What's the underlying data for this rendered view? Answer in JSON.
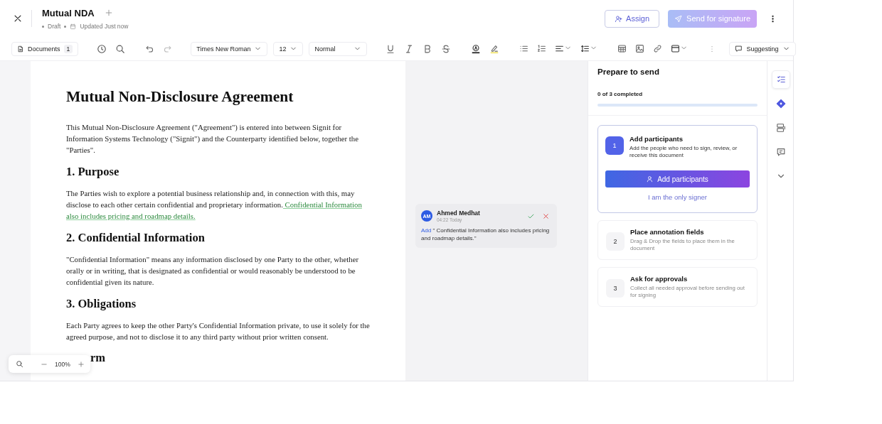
{
  "header": {
    "title": "Mutual NDA",
    "status": "Draft",
    "updated": "Updated Just now",
    "assign": "Assign",
    "send": {
      "label": "Send for signature",
      "disabled": true
    }
  },
  "toolbar": {
    "documents": "Documents",
    "documents_count": "1",
    "font": "Times New Roman",
    "size": "12",
    "style": "Normal",
    "mode": "Suggesting"
  },
  "document": {
    "title": "Mutual Non-Disclosure Agreement",
    "blocks": [
      {
        "kind": "paragraph",
        "text": "This Mutual Non-Disclosure Agreement (\"Agreement\") is entered into between Signit for Information Systems Technology (\"Signit\") and the Counterparty identified below, together the \"Parties\"."
      },
      {
        "kind": "heading",
        "text": "1. Purpose"
      },
      {
        "kind": "paragraph",
        "text": "The Parties wish to explore a potential business relationship and, in connection with this, may disclose to each other certain confidential and proprietary information.",
        "insertion": " Confidential Information also includes pricing and roadmap details."
      },
      {
        "kind": "heading",
        "text": "2. Confidential Information"
      },
      {
        "kind": "paragraph",
        "text": "\"Confidential Information\" means any information disclosed by one Party to the other, whether orally or in writing, that is designated as confidential or would reasonably be understood to be confidential given its nature."
      },
      {
        "kind": "heading",
        "text": "3. Obligations"
      },
      {
        "kind": "paragraph",
        "text": "Each Party agrees to keep the other Party's Confidential Information private, to use it solely for the agreed purpose, and not to disclose it to any third party without prior written consent."
      },
      {
        "kind": "cut-heading",
        "text": "rm"
      }
    ]
  },
  "zoom": {
    "value": "100%"
  },
  "comment": {
    "initials": "AM",
    "author": "Ahmed Medhat",
    "time": "04:22 Today",
    "action": "Add",
    "quote": "\" Confidential Information also includes pricing and roadmap details.\""
  },
  "panel": {
    "title": "Prepare to send",
    "progress_text": "0 of 3 completed",
    "level": 0,
    "steps": [
      {
        "number": "1",
        "title": "Add participants",
        "description": "Add the people who need to sign, review, or receive this document",
        "active": true,
        "primary_action": "Add participants",
        "secondary_action": "I am the only signer"
      },
      {
        "number": "2",
        "title": "Place annotation fields",
        "description": "Drag & Drop the fields to place them in the document",
        "active": false
      },
      {
        "number": "3",
        "title": "Ask for approvals",
        "description": "Collect all needed approval before sending out for signing",
        "active": false
      }
    ]
  },
  "rail": [
    {
      "selected": true
    },
    {
      "selected": false
    },
    {
      "selected": false
    },
    {
      "selected": false
    },
    {
      "selected": false
    }
  ]
}
